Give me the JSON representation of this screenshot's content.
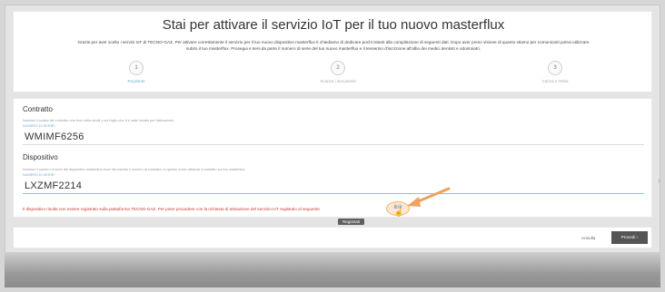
{
  "header": {
    "title": "Stai per attivare il servizio IoT per il tuo nuovo masterflux",
    "intro_line1": "Grazie per aver scelto i servizi IoT di TECNO-GAZ. Per attivare correttamente il servizio per il tuo nuovo dispositivo masterflux ti chiediamo di dedicare pochi istanti alla compilazione di seguenti dati. Dopo aver preso visione di quanto stiamo per comunicarti potrai utilizzare",
    "intro_line2": "subito il tuo masterflux. Prosegui e tieni da parte il numero di serie del tuo nuovo masterflux e il tesserino d'iscrizione all'albo dei medici dentisti e odontoiatri."
  },
  "steps": [
    {
      "number": "1",
      "label": "Registrati"
    },
    {
      "number": "2",
      "label": "Scarica i documenti"
    },
    {
      "number": "3",
      "label": "Carica e Attiva"
    }
  ],
  "contract": {
    "section_title": "Contratto",
    "help": "Inserisci il codice del contratto che trovi nella email o sul foglio che ti è stato inviato per l'attivazione",
    "field_label": "NUMERO DI SERIE*",
    "value": "WMIMF6256"
  },
  "device": {
    "section_title": "Dispositivo",
    "help": "Inserisci il numero di serie del dispositivo masterflux dove hai inserito il numero di contratto, in questo modo attiverai il contratto sul tuo masterflux.",
    "field_label": "NUMERO DI SERIE*",
    "value": "LXZMF2214"
  },
  "error": {
    "message": "Il dispositivo risulta non essere registrato sulla piattaforma TECNO-GAZ. Per poter procedere con la richiesta di attivazione del servizio IoT registralo al seguente",
    "link_label": "link"
  },
  "tooltip": "Registrati",
  "footer": {
    "cancel_label": "Annulla",
    "next_label": "Procedi ›"
  },
  "colors": {
    "accent": "#7fc6d8",
    "error": "#c0392b",
    "highlight": "#f0a060"
  }
}
